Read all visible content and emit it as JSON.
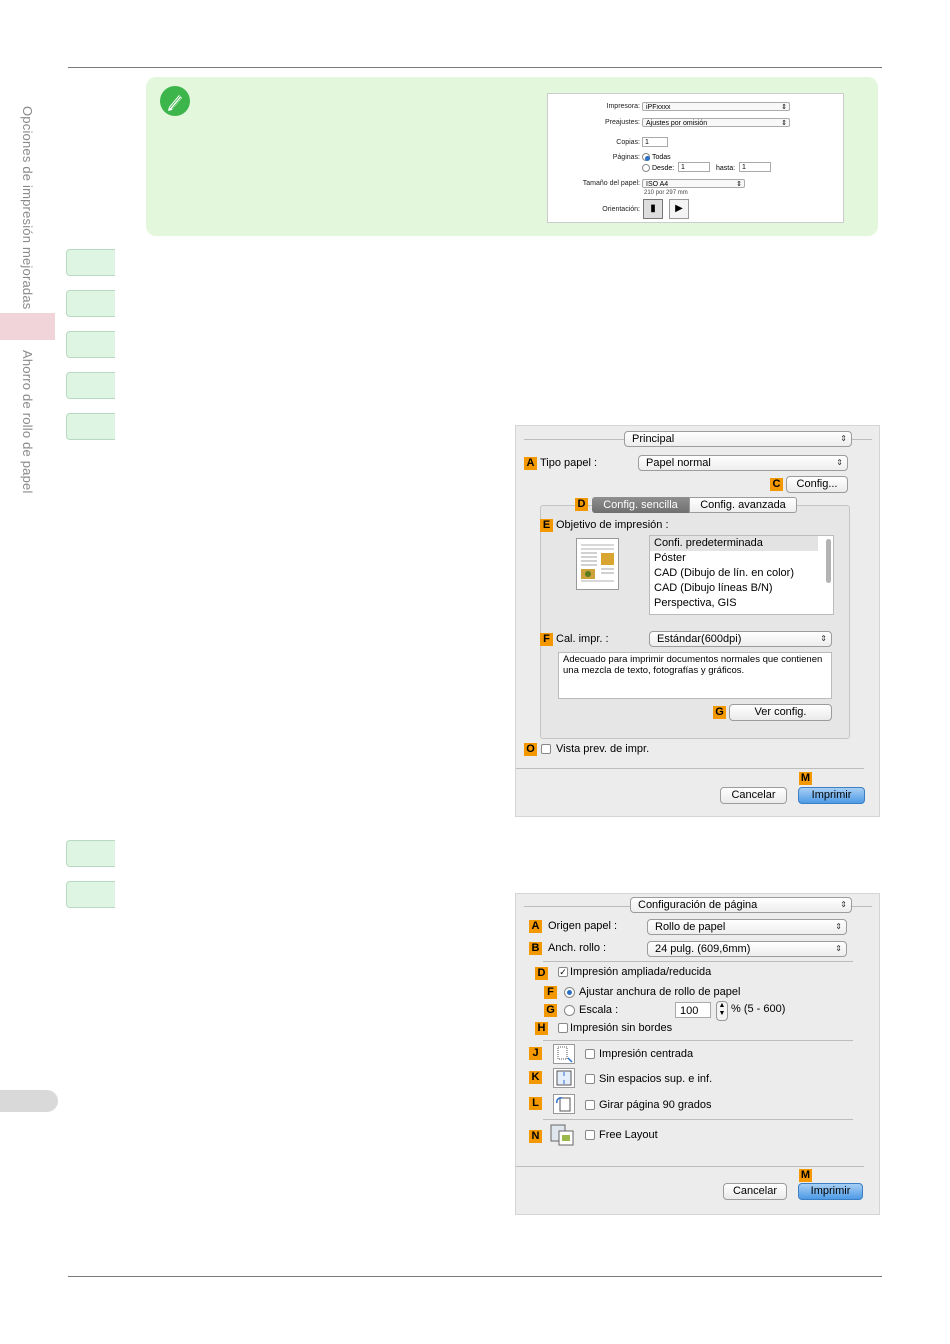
{
  "side": {
    "section_title": "Opciones de impresión mejoradas",
    "subsection_title": "Ahorro de rollo de papel"
  },
  "note_dialog": {
    "printer_label": "Impresora:",
    "printer_value": "iPFxxxx",
    "presets_label": "Preajustes:",
    "presets_value": "Ajustes por omisión",
    "copies_label": "Copias:",
    "copies_value": "1",
    "pages_label": "Páginas:",
    "pages_all": "Todas",
    "pages_from": "Desde:",
    "from_value": "1",
    "to_label": "hasta:",
    "to_value": "1",
    "paper_size_label": "Tamaño del papel:",
    "paper_size_value": "ISO A4",
    "paper_size_sub": "210 por 297 mm",
    "orientation_label": "Orientación:"
  },
  "panel1": {
    "menu": "Principal",
    "A": {
      "badge": "A",
      "label": "Tipo papel :",
      "value": "Papel normal"
    },
    "C": {
      "badge": "C",
      "button": "Config..."
    },
    "D": {
      "badge": "D",
      "tab_simple": "Config. sencilla",
      "tab_advanced": "Config. avanzada"
    },
    "E": {
      "badge": "E",
      "label": "Objetivo de impresión :"
    },
    "list": [
      "Confi. predeterminada",
      "Póster",
      "CAD (Dibujo de lín. en color)",
      "CAD (Dibujo líneas B/N)",
      "Perspectiva, GIS"
    ],
    "F": {
      "badge": "F",
      "label": "Cal. impr. :",
      "value": "Estándar(600dpi)"
    },
    "description": "Adecuado para imprimir documentos normales que contienen una mezcla de texto, fotografías y gráficos.",
    "G": {
      "badge": "G",
      "button": "Ver config."
    },
    "O": {
      "badge": "O",
      "label": "Vista prev. de impr."
    },
    "M": {
      "badge": "M"
    },
    "cancel": "Cancelar",
    "print": "Imprimir"
  },
  "panel2": {
    "menu": "Configuración de página",
    "A": {
      "badge": "A",
      "label": "Origen papel :",
      "value": "Rollo de papel"
    },
    "B": {
      "badge": "B",
      "label": "Anch. rollo :",
      "value": "24 pulg. (609,6mm)"
    },
    "D": {
      "badge": "D",
      "label": "Impresión ampliada/reducida"
    },
    "F": {
      "badge": "F",
      "label": "Ajustar anchura de rollo de papel"
    },
    "G": {
      "badge": "G",
      "label": "Escala :",
      "value": "100",
      "range": "% (5 - 600)"
    },
    "H": {
      "badge": "H",
      "label": "Impresión sin bordes"
    },
    "J": {
      "badge": "J",
      "label": "Impresión centrada"
    },
    "K": {
      "badge": "K",
      "label": "Sin espacios sup. e inf."
    },
    "L": {
      "badge": "L",
      "label": "Girar página 90 grados"
    },
    "N": {
      "badge": "N",
      "label": "Free Layout"
    },
    "M": {
      "badge": "M"
    },
    "cancel": "Cancelar",
    "print": "Imprimir"
  },
  "colors": {
    "badge": "#f39800",
    "note_bg": "#e2f7dc",
    "step_tab": "#dff5e4",
    "side_tab": "#f1d4d9"
  }
}
